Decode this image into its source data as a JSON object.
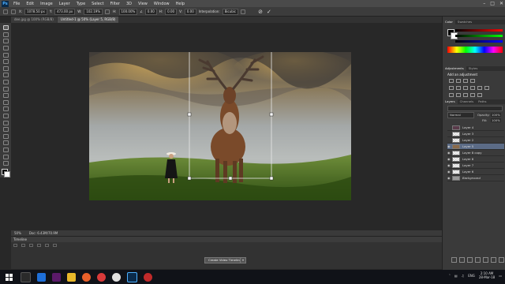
{
  "menubar": {
    "logo": "Ps",
    "items": [
      "File",
      "Edit",
      "Image",
      "Layer",
      "Type",
      "Select",
      "Filter",
      "3D",
      "View",
      "Window",
      "Help"
    ]
  },
  "options": {
    "x_value": "1078.50 px",
    "y_value": "473.00 px",
    "w_value": "102.19%",
    "h_value": "100.00%",
    "angle_value": "0.00",
    "h_skew": "0.00",
    "v_skew": "0.00",
    "interp_label": "Interpolation:",
    "interp_value": "Bicubic"
  },
  "tabs": [
    {
      "label": "dee.jpg @ 100% (RGB/8)",
      "active": false
    },
    {
      "label": "Untitled-1 @ 50% (Layer 5, RGB/8)",
      "active": true
    }
  ],
  "status": {
    "zoom": "50%",
    "doc": "Doc: 6.43M/70.9M"
  },
  "timeline": {
    "title": "Timeline",
    "create_button": "Create Video Timeline"
  },
  "panels": {
    "color_tab": "Color",
    "swatches_tab": "Swatches",
    "adjust_tab": "Adjustments",
    "styles_tab": "Styles",
    "add_adjustment": "Add an adjustment",
    "layers_tab": "Layers",
    "channels_tab": "Channels",
    "paths_tab": "Paths",
    "blend_mode": "Normal",
    "opacity_label": "Opacity:",
    "opacity_value": "100%",
    "fill_label": "Fill:",
    "fill_value": "100%",
    "layers": [
      {
        "name": "Layer 4",
        "selected": false,
        "visible": false
      },
      {
        "name": "Layer 3",
        "selected": false,
        "visible": false
      },
      {
        "name": "Layer 2",
        "selected": false,
        "visible": false
      },
      {
        "name": "Layer 5",
        "selected": true,
        "visible": true
      },
      {
        "name": "Layer 8 copy",
        "selected": false,
        "visible": true
      },
      {
        "name": "Layer 8",
        "selected": false,
        "visible": true
      },
      {
        "name": "Layer 7",
        "selected": false,
        "visible": true
      },
      {
        "name": "Layer 6",
        "selected": false,
        "visible": true
      },
      {
        "name": "Background",
        "selected": false,
        "visible": true
      }
    ]
  },
  "taskbar": {
    "time": "2:10 AM",
    "date": "28-Mar-18",
    "lang": "ENG"
  },
  "colors": {
    "accent": "#5b6b86",
    "ps_blue": "#4db0ff"
  }
}
